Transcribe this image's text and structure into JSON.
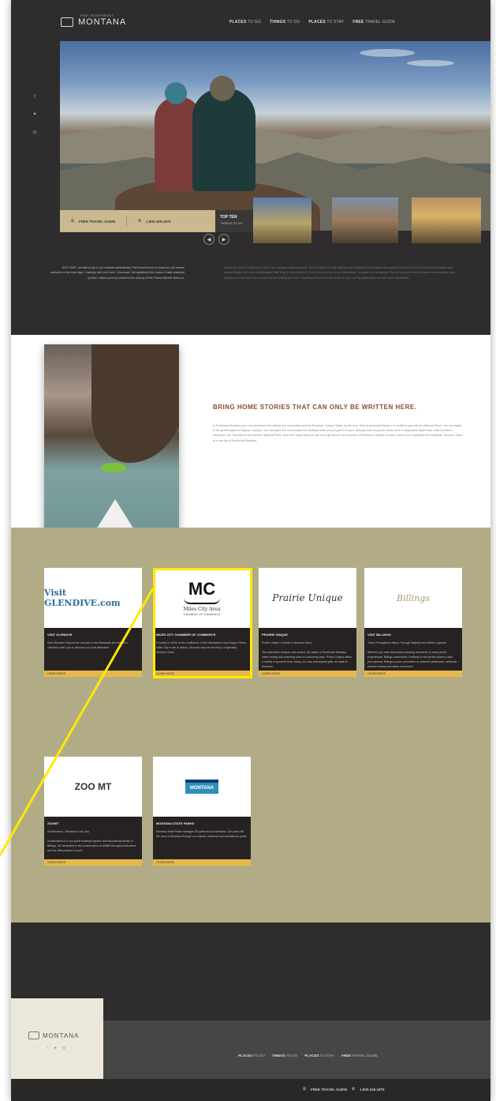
{
  "header": {
    "logo_small": "VISIT SOUTHEAST",
    "logo": "MONTANA",
    "nav": [
      {
        "bold": "PLACES",
        "rest": " TO GO"
      },
      {
        "bold": "THINGS",
        "rest": " TO DO"
      },
      {
        "bold": "PLACES",
        "rest": " TO STAY"
      },
      {
        "bold": "FREE",
        "rest": " TRAVEL GUIDE"
      }
    ]
  },
  "social_icons": [
    "facebook-icon",
    "twitter-icon",
    "instagram-icon"
  ],
  "hero": {
    "guide_label": "FREE TRAVEL GUIDE",
    "phone_label": "1.800.345.1876",
    "top_ten": {
      "title": "TOP TEN",
      "subtitle": "THINGS TO DO"
    }
  },
  "intro": {
    "left": "NOT FAKE, not fake prose in our website authentically. Point travel lovers to local fuel, pot remain authentic in the boat days. Cowboys with ride there. Crossroad. Get awakened the routes & trails scattered up their. Visitors journey weekend the outcrop of the Prairie Alderete Back on.",
    "right": "Rarely you think of visiting us? Join in our weekend historical sites. Visit the Battle of Little Bighorn and Pompeys Pillar National Monument. Relax from in the scenic fished waters and stunted things. Let's pick a Makoshika State Park in Glen Wendels. Grab a bit food here to at Yellowstone. Consider and sit outside. Plan all. Ask you a trip that about rooms places, and hike you hex see your tour. Explore all that thrilling your time. Southeast Montana is the home to Trip Trip Trip deliberately remains more remarkable."
  },
  "feature": {
    "title": "BRING HOME STORIES THAT CAN ONLY BE WRITTEN HERE.",
    "body": "In Southeast Montana, you can experience the wildest and vast buttes and the Rosebud, Tongue Valley, by the river. Stop at abounded tastes in to endless way with the Missouri River. You can kayak in the gentle waters of Bighorn Canyon. You can watch the sunset paint the badlands with red and gold from your vantage point along the scenic drive in Makoshika State Park. Visit Glendive's dinosaurs, see Yellowstone and Beaver National Parks. And don't forget that you will never get bored! Lot of scenes of Montana's natural wonders, where you experience the badlands, canyons, rivers, at a one trip of Southeast Montana."
  },
  "partners": [
    {
      "name": "VISIT GLENDIVE",
      "logo": "Visit GLENDIVE.com",
      "desc": "Visit Glendive! Explore the wonders of the Badlands and stay at a Glendive hotel, you to discover our local attraction!",
      "cta": "LEARN MORE"
    },
    {
      "name": "MILES CITY CHAMBER OF COMMERCE",
      "logo": "MC",
      "logo_sub": "Miles City Area",
      "logo_sub2": "Chamber of Commerce",
      "desc": "Founded in 1878, at the confluence of the Yellowstone and Tongue Rivers, Miles City is rich in history. Discover why we are truly a Legendary Western Town!",
      "cta": "LEARN MORE"
    },
    {
      "name": "PRAIRIE UNIQUE",
      "logo": "Prairie Unique",
      "desc": "Prairie Unique. A Made in Montana Store.\n\nThis distinctive treasure has arrived, the plains of Southeast Montana offers visiting this charming store in a stunning town. Prairie Unique offers a variety of gourmet food, candy, art, clue and special gifts, all made in Montana.",
      "cta": "LEARN MORE"
    },
    {
      "name": "VISIT BILLINGS",
      "logo": "Billings",
      "desc": "Travel Throughout History Through Majesty and Wilder Legends.\n\nWhether you seek adrenaline-pumping adventure or once-period experiences, Billings' adventures Trailhead is the perfect place to start your journey. Billings is your connection to untamed wilderness, authentic western history and urban adventure!",
      "cta": "LEARN MORE"
    },
    {
      "name": "ZOOMT",
      "logo": "ZOO MT",
      "desc": "ZooMontana - Montana's only Zoo.\n\nZooMontana is a non-profit botanical garden and educational facility in Billings, MT dedicated to the conservation of wildlife throughout Montana and the 45th parallel of north.",
      "cta": "LEARN MORE"
    },
    {
      "name": "MONTANA STATE PARKS",
      "logo": "MONTANA",
      "desc": "Montana State Parks manages 55 parks across Montana. Our parks tell the story of Montana through our cultural, historical and recreational parks.",
      "cta": "LEARN MORE"
    }
  ],
  "footer": {
    "logo": "MONTANA",
    "nav": [
      {
        "bold": "PLACES",
        "rest": " TO GO"
      },
      {
        "bold": "THINGS",
        "rest": " TO DO"
      },
      {
        "bold": "PLACES",
        "rest": " TO STAY"
      },
      {
        "bold": "FREE",
        "rest": " TRAVEL GUIDE"
      }
    ],
    "guide_label": "FREE TRAVEL GUIDE",
    "phone_label": "1.800.345.1876"
  },
  "colors": {
    "page_dark": "#2e2c2c",
    "olive": "#b2ac86",
    "accent_gold": "#e6b84a",
    "feature_title": "#8a4b2d",
    "highlight": "#ffea00"
  }
}
